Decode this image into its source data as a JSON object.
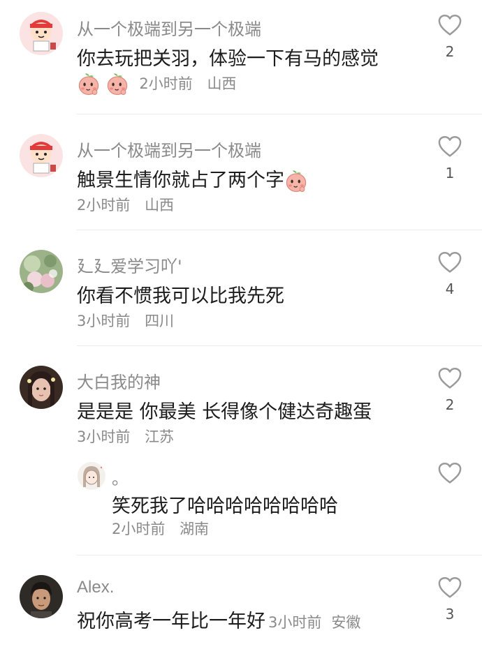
{
  "comments": [
    {
      "username": "从一个极端到另一个极端",
      "text": "你去玩把关羽，体验一下有马的感觉",
      "time": "2小时前",
      "location": "山西",
      "likes": "2",
      "avatar_icon": "crayon-boy-avatar"
    },
    {
      "username": "从一个极端到另一个极端",
      "text": "触景生情你就占了两个字",
      "time": "2小时前",
      "location": "山西",
      "likes": "1",
      "avatar_icon": "crayon-boy-avatar"
    },
    {
      "username": "廴廴爱学习吖'",
      "text": "你看不惯我可以比我先死",
      "time": "3小时前",
      "location": "四川",
      "likes": "4",
      "avatar_icon": "flowers-photo-avatar"
    },
    {
      "username": "大白我的神",
      "text": "是是是 你最美 长得像个健达奇趣蛋",
      "time": "3小时前",
      "location": "江苏",
      "likes": "2",
      "avatar_icon": "girl-photo-avatar"
    },
    {
      "username": "。",
      "text": "笑死我了哈哈哈哈哈哈哈哈",
      "time": "2小时前",
      "location": "湖南",
      "likes": "",
      "avatar_icon": "sketch-girl-avatar"
    },
    {
      "username": "Alex.",
      "text": "祝你高考一年比一年好",
      "time": "3小时前",
      "location": "安徽",
      "likes": "3",
      "avatar_icon": "boy-photo-avatar"
    }
  ],
  "colors": {
    "meta_text": "#8a8a8a",
    "body_text": "#1c1c1c",
    "divider": "#ececec",
    "heart_stroke": "#9a9a9a",
    "peach_emoji": "#f4a9a0"
  }
}
